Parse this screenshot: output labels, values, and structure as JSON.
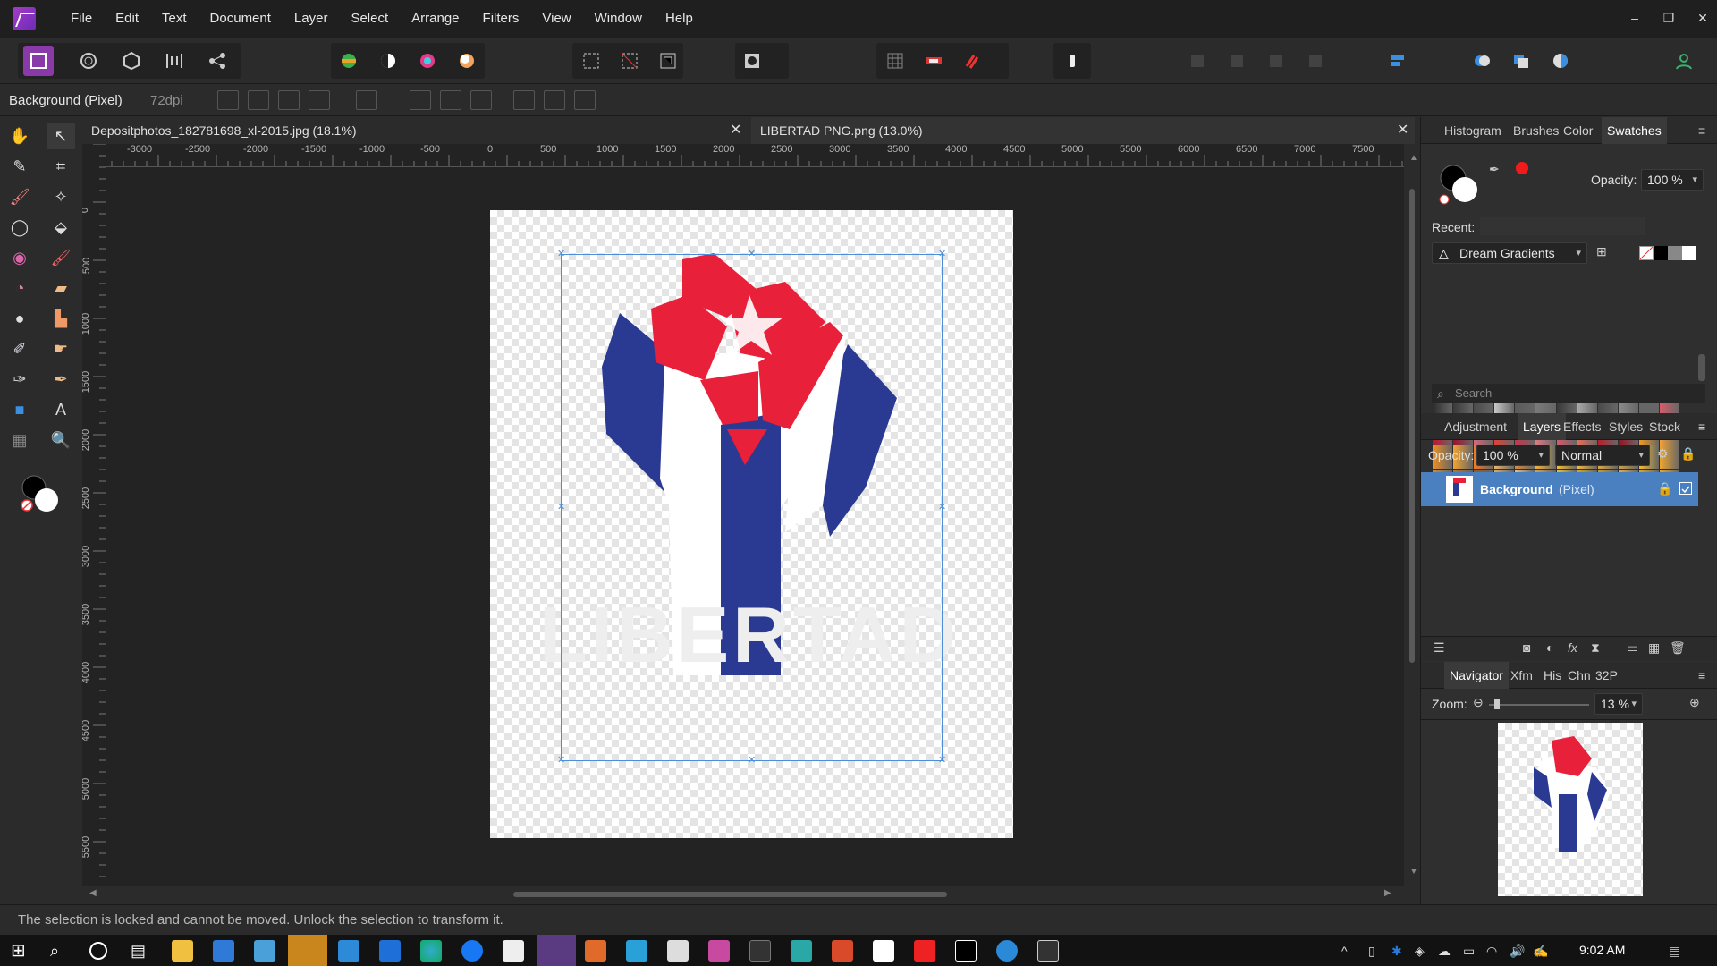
{
  "menubar": {
    "items": [
      "File",
      "Edit",
      "Text",
      "Document",
      "Layer",
      "Select",
      "Arrange",
      "Filters",
      "View",
      "Window",
      "Help"
    ],
    "window_controls": [
      "–",
      "❐",
      "✕"
    ]
  },
  "context": {
    "layer_name": "Background (Pixel)",
    "dpi": "72dpi"
  },
  "tabs": [
    {
      "label": "Depositphotos_182781698_xl-2015.jpg (18.1%)"
    },
    {
      "label": "LIBERTAD PNG.png (13.0%)"
    }
  ],
  "rulers": {
    "unit": "px",
    "h_labels": [
      "-3000",
      "-2500",
      "-2000",
      "-1500",
      "-1000",
      "-500",
      "0",
      "500",
      "1000",
      "1500",
      "2000",
      "2500",
      "3000",
      "3500",
      "4000",
      "4500",
      "5000",
      "5500",
      "6000",
      "6500",
      "7000",
      "7500"
    ],
    "v_labels": [
      "0",
      "500",
      "1000",
      "1500",
      "2000",
      "2500",
      "3000",
      "3500",
      "4000",
      "4500",
      "5000",
      "5500"
    ]
  },
  "canvas": {
    "watermark_text": "LIBERTAD"
  },
  "swatches_panel": {
    "tabs": [
      "Histogram",
      "Brushes",
      "Color",
      "Swatches"
    ],
    "active_tab": "Swatches",
    "opacity_label": "Opacity:",
    "opacity_value": "100 %",
    "recent_label": "Recent:",
    "palette": "Dream Gradients",
    "search_placeholder": "Search",
    "colors": [
      "#2d2d2d",
      "#3a3a3a",
      "#4b4b4b",
      "#c9c9c9",
      "#5a5a5a",
      "#7a7a7a",
      "#393939",
      "#a9a9a9",
      "#4a4a4a",
      "#8c8c8c",
      "#666666",
      "#d85d6a",
      "#c8102e",
      "#a50e2d",
      "#d46a78",
      "#e3413a",
      "#c8354a",
      "#e07a86",
      "#d65a69",
      "#e86f56",
      "#b81e2c",
      "#9b1020",
      "#f29a1f",
      "#f4a23a",
      "#f0901e",
      "#f2a431",
      "#f07b22",
      "#e8b36b",
      "#d9893e",
      "#f4b23a",
      "#f5c12a",
      "#f3b73d",
      "#d8a848",
      "#cfa24c",
      "#f2be2d",
      "#f0a62e",
      "#c98d3e",
      "#b97232",
      "#9c5a27",
      "#d3ac6d",
      "#e0c08a",
      "#c9a45b",
      "#e6c33e",
      "#d1aa20",
      "#c99a2f",
      "#e2b04a",
      "#d9a435",
      "#e5a92a"
    ]
  },
  "layers_panel": {
    "tabs": [
      "Adjustment",
      "Layers",
      "Effects",
      "Styles",
      "Stock"
    ],
    "active_tab": "Layers",
    "opacity_label": "Opacity:",
    "opacity_value": "100 %",
    "blend_mode": "Normal",
    "layers": [
      {
        "name": "Background",
        "kind": "(Pixel)",
        "visible": true
      }
    ]
  },
  "navigator_panel": {
    "tabs": [
      "Navigator",
      "Xfm",
      "His",
      "Chn",
      "32P"
    ],
    "active_tab": "Navigator",
    "zoom_label": "Zoom:",
    "zoom_value": "13 %"
  },
  "status": {
    "message": "The selection is locked and cannot be moved. Unlock the selection to transform it."
  },
  "taskbar": {
    "time": "9:02 AM"
  },
  "colors": {
    "selection": "#4a8fd8",
    "fist_red": "#e8203a",
    "fist_blue": "#2a3a92",
    "layer_highlight": "#4a7fc0"
  }
}
